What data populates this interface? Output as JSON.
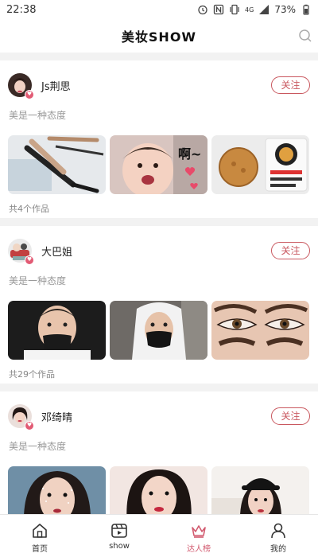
{
  "status_bar": {
    "time": "22:38",
    "network": "4G",
    "battery": "73%",
    "icons": [
      "alarm-icon",
      "nfc-icon",
      "vibrate-icon",
      "signal-icon",
      "battery-icon"
    ]
  },
  "header": {
    "title": "美妆SHOW",
    "search_icon": "search-icon"
  },
  "cards": [
    {
      "username": "Js荆思",
      "follow_label": "关注",
      "motto": "美是一种态度",
      "works_count": "共4个作品",
      "thumbnails": [
        "makeup-brushes",
        "baby-face-sticker",
        "mooncake-snack"
      ],
      "thumbnail_text": [
        "啊~"
      ]
    },
    {
      "username": "大巴姐",
      "follow_label": "关注",
      "motto": "美是一种态度",
      "works_count": "共29个作品",
      "thumbnails": [
        "man-face-mask",
        "man-hoodie-mask",
        "eye-makeup-closeup"
      ]
    },
    {
      "username": "邓绮晴",
      "follow_label": "关注",
      "motto": "美是一种态度",
      "works_count": "",
      "thumbnails": [
        "woman-glitter-makeup",
        "woman-red-lips",
        "woman-black-hat"
      ]
    }
  ],
  "tabbar": {
    "tabs": [
      {
        "label": "首页",
        "icon": "home-icon",
        "active": false
      },
      {
        "label": "show",
        "icon": "video-icon",
        "active": false
      },
      {
        "label": "达人榜",
        "icon": "crown-icon",
        "active": true
      },
      {
        "label": "我的",
        "icon": "person-icon",
        "active": false
      }
    ]
  },
  "colors": {
    "accent": "#c9585f",
    "active_tab": "#d25a6f",
    "background": "#f2f2f2"
  }
}
